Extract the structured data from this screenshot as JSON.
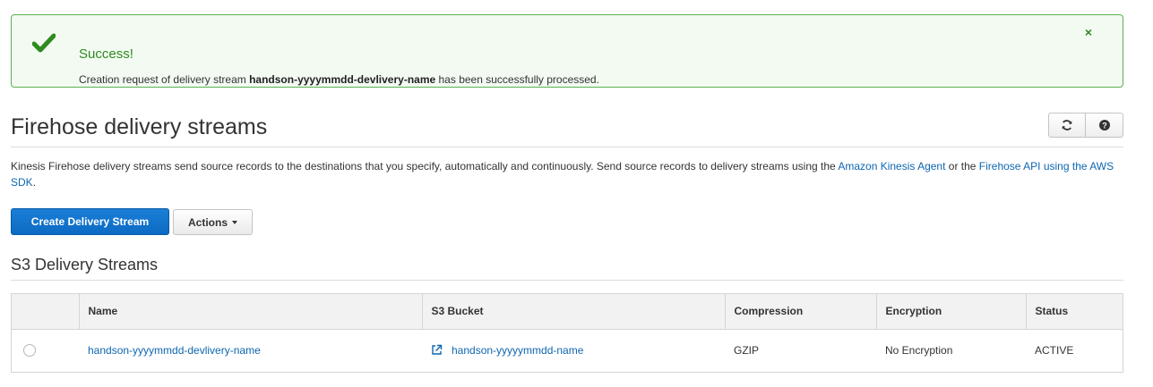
{
  "alert": {
    "title": "Success!",
    "message_prefix": "Creation request of delivery stream ",
    "stream_name": "handson-yyyymmdd-devlivery-name",
    "message_suffix": " has been successfully processed.",
    "close_glyph": "×",
    "icons": {
      "status": "checkmark-icon",
      "close": "close-icon"
    },
    "color": "#2f8a1f"
  },
  "header": {
    "title": "Firehose delivery streams",
    "icons": [
      "refresh-icon",
      "help-icon"
    ]
  },
  "description": {
    "text_1": "Kinesis Firehose delivery streams send source records to the destinations that you specify, automatically and continuously. Send source records to delivery streams using the ",
    "link_1": "Amazon Kinesis Agent",
    "text_2": " or the ",
    "link_2": "Firehose API using the AWS SDK",
    "text_3": "."
  },
  "toolbar": {
    "create_label": "Create Delivery Stream",
    "actions_label": "Actions"
  },
  "section": {
    "title": "S3 Delivery Streams"
  },
  "table": {
    "columns": [
      "",
      "Name",
      "S3 Bucket",
      "Compression",
      "Encryption",
      "Status"
    ],
    "rows": [
      {
        "name": "handson-yyyymmdd-devlivery-name",
        "s3_bucket": "handson-yyyyymmdd-name",
        "compression": "GZIP",
        "encryption": "No Encryption",
        "status": "ACTIVE"
      }
    ]
  },
  "colors": {
    "primary": "#0d6ac3",
    "link": "#0e66b0",
    "success_border": "#5bb052",
    "success_bg": "#f2faf1"
  }
}
